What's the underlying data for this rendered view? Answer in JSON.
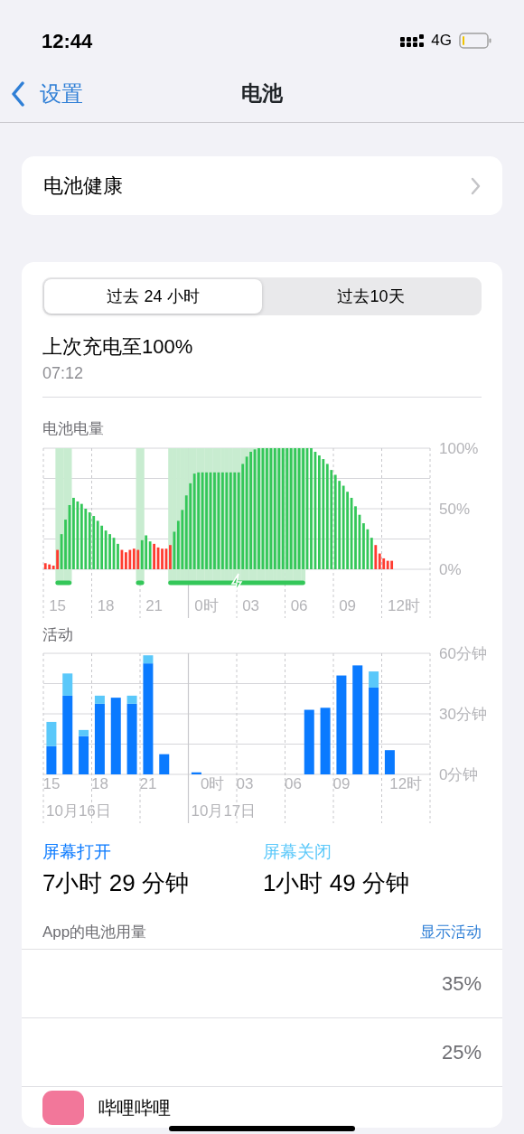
{
  "status_bar": {
    "time": "12:44",
    "network": "4G"
  },
  "nav": {
    "back": "设置",
    "title": "电池"
  },
  "health_row": {
    "label": "电池健康"
  },
  "segments": [
    {
      "label": "过去 24 小时",
      "selected": true
    },
    {
      "label": "过去10天",
      "selected": false
    }
  ],
  "last_charge": {
    "title": "上次充电至100%",
    "time": "07:12"
  },
  "battery_level": {
    "label": "电池电量",
    "charging": [
      false,
      false,
      false,
      true,
      true,
      true,
      true,
      false,
      false,
      false,
      false,
      false,
      false,
      false,
      false,
      false,
      false,
      false,
      false,
      false,
      false,
      false,
      false,
      true,
      true,
      false,
      false,
      false,
      false,
      false,
      false,
      true,
      true,
      true,
      true,
      true,
      true,
      true,
      true,
      true,
      true,
      true,
      true,
      true,
      true,
      true,
      true,
      true,
      true,
      true,
      true,
      true,
      true,
      true,
      true,
      true,
      true,
      true,
      true,
      true,
      true,
      true,
      true,
      true,
      true,
      false,
      false,
      false,
      false,
      false,
      false,
      false,
      false,
      false,
      false,
      false,
      false,
      false,
      false,
      false,
      false,
      false,
      false,
      false,
      false,
      false,
      false
    ],
    "chart_data": {
      "type": "bar",
      "grid": true,
      "ylim": [
        0,
        100
      ],
      "categories": [
        null,
        null,
        null,
        "15",
        null,
        null,
        null,
        null,
        null,
        null,
        null,
        null,
        null,
        null,
        null,
        "18",
        null,
        null,
        null,
        null,
        null,
        null,
        null,
        null,
        null,
        null,
        null,
        "21",
        null,
        null,
        null,
        null,
        null,
        null,
        null,
        null,
        null,
        null,
        null,
        null,
        "0时",
        null,
        null,
        null,
        null,
        null,
        null,
        null,
        null,
        null,
        null,
        "03",
        null,
        null,
        null,
        null,
        null,
        null,
        null,
        null,
        null,
        null,
        null,
        "06",
        null,
        null,
        null,
        null,
        null,
        null,
        null,
        null,
        null,
        null,
        null,
        "09",
        null,
        null,
        null,
        null,
        null,
        null,
        null,
        null,
        null,
        null,
        null,
        null,
        null,
        "12时",
        null,
        null,
        null,
        null,
        null,
        null
      ],
      "yticks": [
        {
          "value": 0,
          "label": "0%"
        },
        {
          "value": 50,
          "label": "50%"
        },
        {
          "value": 100,
          "label": "100%"
        }
      ],
      "series": [
        {
          "color": "#34c759",
          "values": [
            null,
            null,
            null,
            null,
            29,
            41,
            53,
            59,
            56,
            54,
            50,
            47,
            44,
            40,
            36,
            32,
            29,
            26,
            21,
            null,
            null,
            null,
            null,
            null,
            24,
            28,
            23,
            null,
            null,
            null,
            null,
            null,
            31,
            40,
            49,
            61,
            71,
            79,
            80,
            80,
            80,
            80,
            80,
            80,
            80,
            80,
            80,
            80,
            80,
            87,
            93,
            97,
            99,
            100,
            100,
            100,
            100,
            100,
            100,
            100,
            100,
            100,
            100,
            100,
            100,
            100,
            100,
            97,
            94,
            91,
            87,
            82,
            78,
            73,
            69,
            64,
            59,
            52,
            45,
            38,
            33,
            26,
            null,
            null,
            null,
            null,
            null,
            null,
            null,
            null,
            null,
            null,
            null,
            null,
            null,
            null
          ]
        },
        {
          "color": "#ff3b30",
          "values": [
            5,
            4,
            3,
            16,
            null,
            null,
            null,
            null,
            null,
            null,
            null,
            null,
            null,
            null,
            null,
            null,
            null,
            null,
            null,
            16,
            14,
            16,
            17,
            16,
            null,
            null,
            null,
            21,
            18,
            17,
            17,
            20,
            null,
            null,
            null,
            null,
            null,
            null,
            null,
            null,
            null,
            null,
            null,
            null,
            null,
            null,
            null,
            null,
            null,
            null,
            null,
            null,
            null,
            null,
            null,
            null,
            null,
            null,
            null,
            null,
            null,
            null,
            null,
            null,
            null,
            null,
            null,
            null,
            null,
            null,
            null,
            null,
            null,
            null,
            null,
            null,
            null,
            null,
            null,
            null,
            null,
            null,
            20,
            13,
            9,
            7,
            7,
            null,
            null,
            null,
            null,
            null,
            null,
            null,
            null,
            null
          ]
        }
      ]
    }
  },
  "activity": {
    "label": "活动",
    "dates": [
      "10月16日",
      "10月17日"
    ],
    "chart_data": {
      "type": "bar",
      "stacked": true,
      "grid": true,
      "ylim": [
        0,
        60
      ],
      "categories": [
        "15",
        null,
        null,
        "18",
        null,
        null,
        "21",
        null,
        null,
        null,
        "0时",
        null,
        "03",
        null,
        null,
        "06",
        null,
        null,
        "09",
        null,
        null,
        null,
        "12时",
        null
      ],
      "yticks": [
        {
          "value": 0,
          "label": "0分钟"
        },
        {
          "value": 30,
          "label": "30分钟"
        },
        {
          "value": 60,
          "label": "60分钟"
        }
      ],
      "series": [
        {
          "color": "#0a7aff",
          "values": [
            14,
            39,
            19,
            35,
            38,
            35,
            55,
            10,
            0,
            1,
            0,
            0,
            0,
            0,
            0,
            0,
            32,
            33,
            49,
            54,
            43,
            12,
            null,
            null
          ]
        },
        {
          "color": "#5ac8fa",
          "values": [
            12,
            11,
            3,
            4,
            0,
            4,
            4,
            0,
            0,
            0,
            0,
            0,
            0,
            0,
            0,
            0,
            0,
            0,
            0,
            0,
            8,
            0,
            null,
            null
          ]
        }
      ]
    }
  },
  "screen_time": [
    {
      "label": "屏幕打开",
      "value": "7小时 29 分钟",
      "color": "#0a7aff"
    },
    {
      "label": "屏幕关闭",
      "value": "1小时 49 分钟",
      "color": "#5ac8fa"
    }
  ],
  "app_usage": {
    "title": "App的电池用量",
    "action": "显示活动",
    "apps": [
      {
        "percent": "35%"
      },
      {
        "percent": "25%"
      },
      {
        "name": "哔哩哔哩"
      }
    ]
  }
}
